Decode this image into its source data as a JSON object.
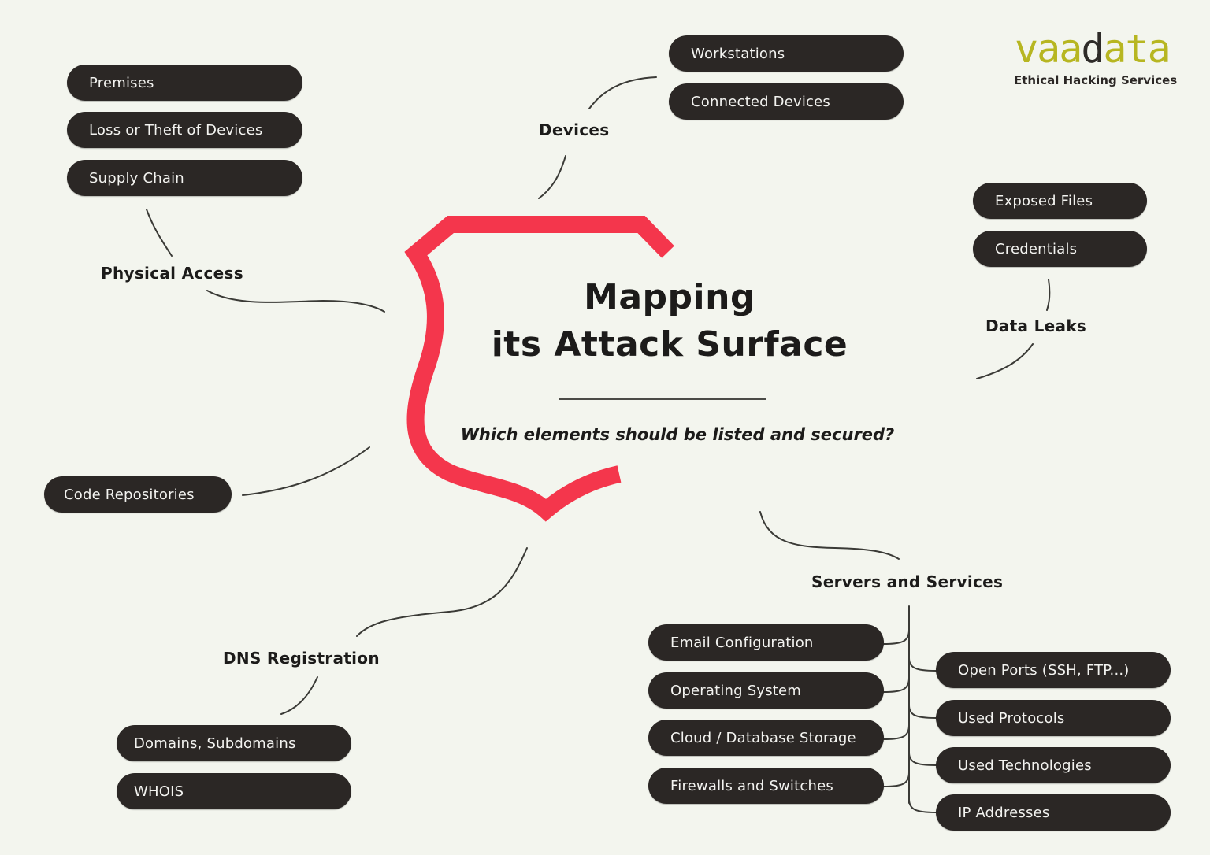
{
  "brand": {
    "logo_part1": "vaa",
    "logo_part2": "d",
    "logo_part3": "ata",
    "tagline": "Ethical Hacking Services",
    "accent_color": "#b7b621",
    "shield_color": "#f4364c"
  },
  "center": {
    "title_line1": "Mapping",
    "title_line2": "its Attack Surface",
    "subtitle": "Which elements should be listed and secured?"
  },
  "branches": {
    "physical_access": {
      "label": "Physical Access",
      "items": [
        "Premises",
        "Loss or Theft of Devices",
        "Supply Chain"
      ]
    },
    "devices": {
      "label": "Devices",
      "items": [
        "Workstations",
        "Connected Devices"
      ]
    },
    "data_leaks": {
      "label": "Data Leaks",
      "items": [
        "Exposed Files",
        "Credentials"
      ]
    },
    "code_repositories": {
      "items": [
        "Code Repositories"
      ]
    },
    "dns_registration": {
      "label": "DNS Registration",
      "items": [
        "Domains, Subdomains",
        "WHOIS"
      ]
    },
    "servers_services": {
      "label": "Servers and Services",
      "left_items": [
        "Email Configuration",
        "Operating System",
        "Cloud / Database Storage",
        "Firewalls and Switches"
      ],
      "right_items": [
        "Open Ports (SSH, FTP...)",
        "Used Protocols",
        "Used Technologies",
        "IP Addresses"
      ]
    }
  }
}
